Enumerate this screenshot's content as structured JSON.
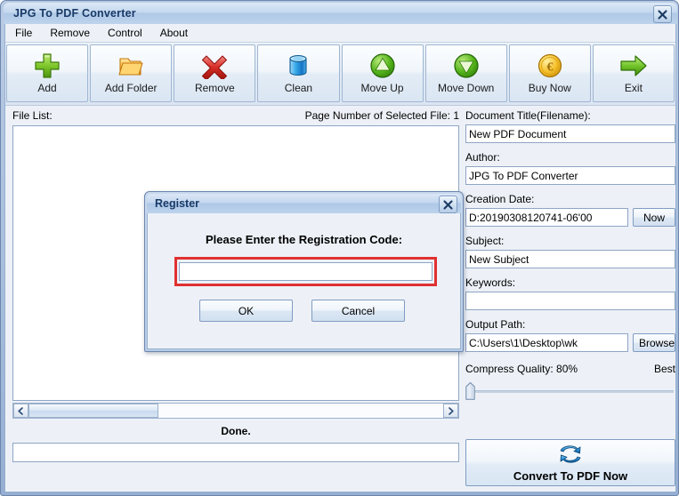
{
  "window": {
    "title": "JPG To PDF Converter",
    "close_icon": "close-icon"
  },
  "menu": {
    "items": [
      {
        "label": "File"
      },
      {
        "label": "Remove"
      },
      {
        "label": "Control"
      },
      {
        "label": "About"
      }
    ]
  },
  "toolbar": {
    "buttons": [
      {
        "label": "Add",
        "icon": "green-plus-icon"
      },
      {
        "label": "Add Folder",
        "icon": "folder-icon"
      },
      {
        "label": "Remove",
        "icon": "red-x-icon"
      },
      {
        "label": "Clean",
        "icon": "blue-bin-icon"
      },
      {
        "label": "Move Up",
        "icon": "arrow-up-circle-icon"
      },
      {
        "label": "Move Down",
        "icon": "arrow-down-circle-icon"
      },
      {
        "label": "Buy Now",
        "icon": "gold-coin-icon"
      },
      {
        "label": "Exit",
        "icon": "green-arrow-right-icon"
      }
    ]
  },
  "left_panel": {
    "file_list_label": "File List:",
    "page_number_label": "Page Number of Selected File: 1",
    "file_list_items": [],
    "scrollbar": {
      "left_arrow_icon": "chevron-left-icon",
      "right_arrow_icon": "chevron-right-icon"
    },
    "status_text": "Done.",
    "progress_value": ""
  },
  "right_panel": {
    "document_title": {
      "label": "Document Title(Filename):",
      "value": "New PDF Document"
    },
    "author": {
      "label": "Author:",
      "value": "JPG To PDF Converter"
    },
    "creation_date": {
      "label": "Creation Date:",
      "value": "D:20190308120741-06'00",
      "now_button": "Now"
    },
    "subject": {
      "label": "Subject:",
      "value": "New Subject"
    },
    "keywords": {
      "label": "Keywords:",
      "value": ""
    },
    "output_path": {
      "label": "Output Path:",
      "value": "C:\\Users\\1\\Desktop\\wk",
      "browse_button": "Browse"
    },
    "compress_quality": {
      "label": "Compress Quality: 80%",
      "best_label": "Best",
      "percent": 80
    },
    "convert_button": {
      "label": "Convert To PDF Now",
      "icon": "convert-arrows-icon"
    }
  },
  "dialog": {
    "title": "Register",
    "close_icon": "close-icon",
    "prompt": "Please Enter the Registration Code:",
    "code_value": "",
    "ok_label": "OK",
    "cancel_label": "Cancel",
    "highlight_color": "#e03030"
  },
  "colors": {
    "title_text": "#173a67",
    "window_chrome": "#b0c9e7",
    "client_background": "#edf1f7",
    "field_border": "#8ea5c4"
  }
}
